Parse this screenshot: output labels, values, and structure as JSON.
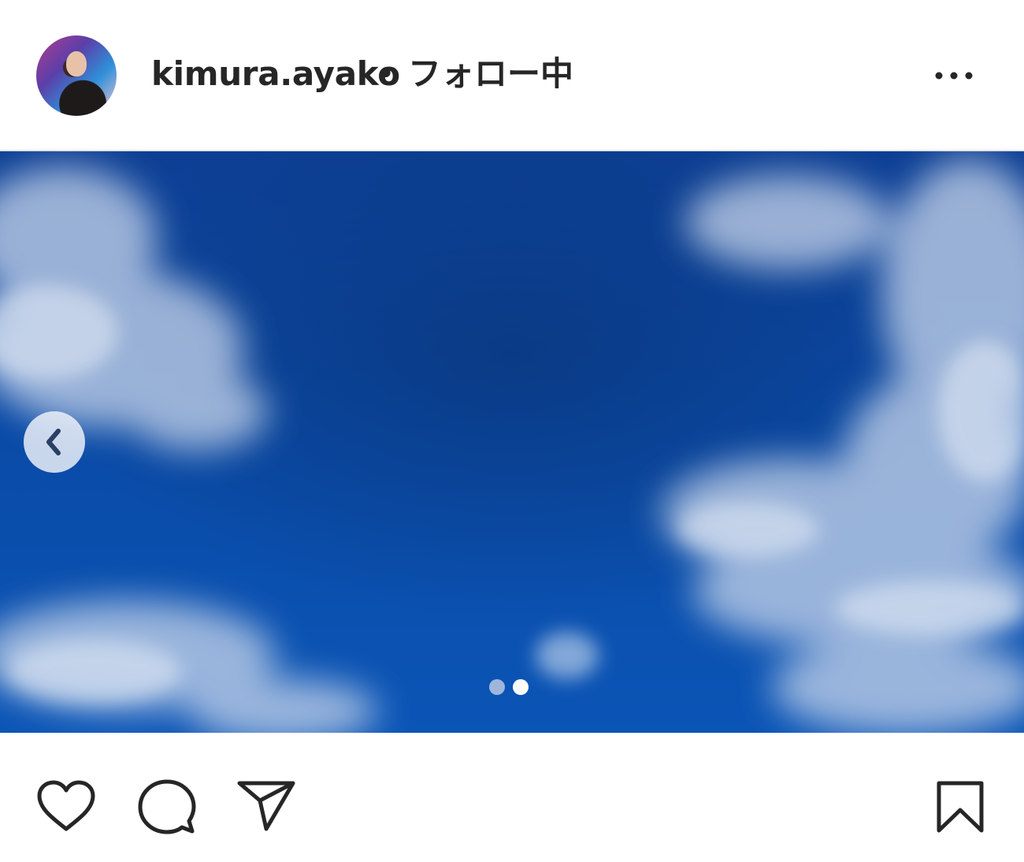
{
  "post": {
    "username": "kimura.ayako",
    "separator": "•",
    "follow_status": "フォロー中",
    "more_icon": "more-horizontal-icon",
    "avatar_icon": "profile-avatar"
  },
  "carousel": {
    "total_slides": 2,
    "current_slide": 2,
    "prev_icon": "chevron-left-icon",
    "dot_active_color": "#ffffff",
    "dot_inactive_color": "#9fb6dc"
  },
  "actions": {
    "like_icon": "heart-icon",
    "comment_icon": "comment-icon",
    "share_icon": "send-icon",
    "save_icon": "bookmark-icon"
  },
  "colors": {
    "text": "#262626",
    "sky": "#0a4aa6"
  }
}
